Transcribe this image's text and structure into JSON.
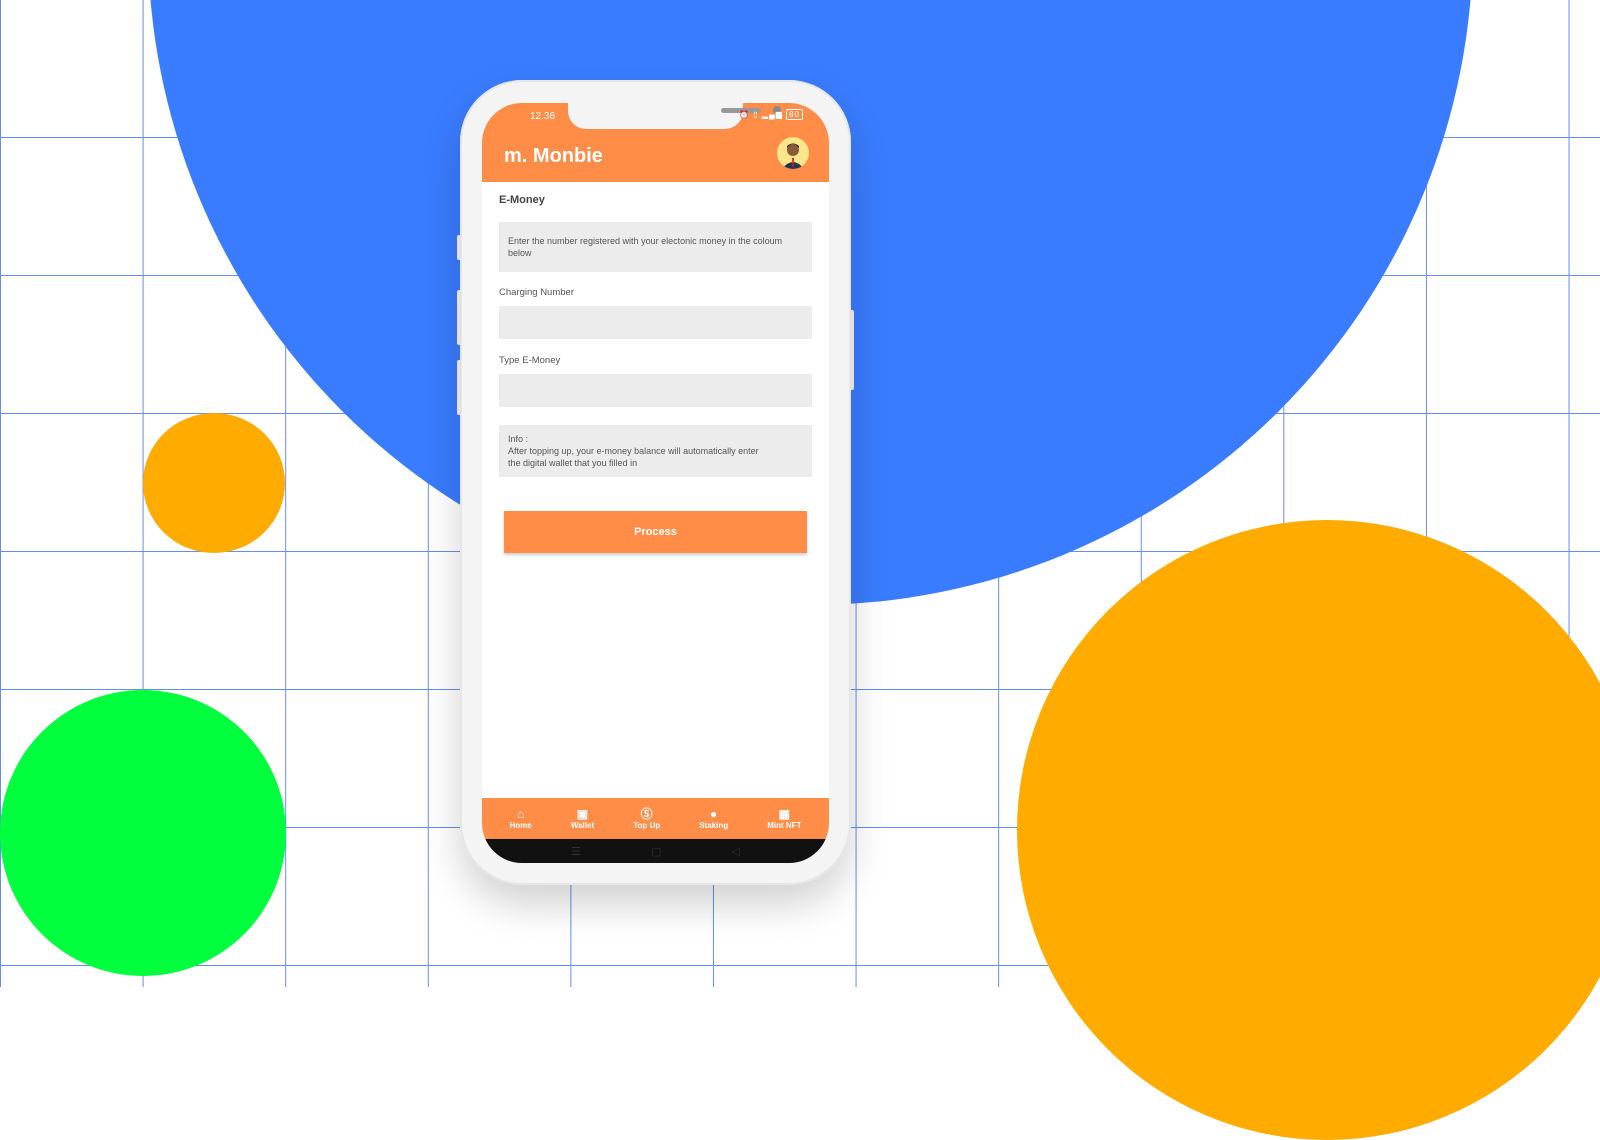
{
  "colors": {
    "accent": "#FF8C47",
    "blue": "#3A7CFF",
    "orange": "#FFAB00",
    "green": "#00FF3C"
  },
  "status_bar": {
    "time": "12.36",
    "battery": "80"
  },
  "app": {
    "name": "Monbie",
    "logo_mark": "m."
  },
  "page": {
    "title": "E-Money",
    "instruction": "Enter the number registered with your electonic money in the coloum below",
    "charging_number_label": "Charging Number",
    "charging_number_value": "",
    "type_label": "Type E-Money",
    "type_value": "",
    "info_title": "Info :",
    "info_text": "After topping up, your e-money balance will automatically enter the digital wallet that you filled in",
    "process_label": "Process"
  },
  "nav": [
    {
      "label": "Home",
      "icon": "home-icon"
    },
    {
      "label": "Wallet",
      "icon": "wallet-icon"
    },
    {
      "label": "Top Up",
      "icon": "dollar-icon"
    },
    {
      "label": "Staking",
      "icon": "coins-icon"
    },
    {
      "label": "Mint NFT",
      "icon": "nft-icon"
    }
  ]
}
